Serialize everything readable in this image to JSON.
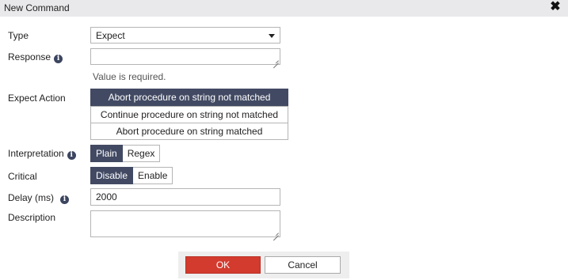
{
  "dialog": {
    "title": "New Command",
    "close_glyph": "✖"
  },
  "form": {
    "type": {
      "label": "Type",
      "value": "Expect"
    },
    "response": {
      "label": "Response",
      "value": "",
      "error": "Value is required."
    },
    "expect_action": {
      "label": "Expect Action",
      "options": [
        "Abort procedure on string not matched",
        "Continue procedure on string not matched",
        "Abort procedure on string matched"
      ],
      "selected_index": 0
    },
    "interpretation": {
      "label": "Interpretation",
      "options": [
        "Plain",
        "Regex"
      ],
      "selected": "Plain"
    },
    "critical": {
      "label": "Critical",
      "options": [
        "Disable",
        "Enable"
      ],
      "selected": "Disable"
    },
    "delay": {
      "label": "Delay (ms)",
      "value": "2000"
    },
    "description": {
      "label": "Description",
      "value": ""
    }
  },
  "buttons": {
    "ok": "OK",
    "cancel": "Cancel"
  },
  "icons": {
    "info": "info-icon",
    "close": "close-icon",
    "caret": "chevron-down-icon"
  },
  "colors": {
    "selected_bg": "#424a63",
    "ok_bg": "#d33b2f",
    "titlebar_bg": "#e9e9eb"
  }
}
